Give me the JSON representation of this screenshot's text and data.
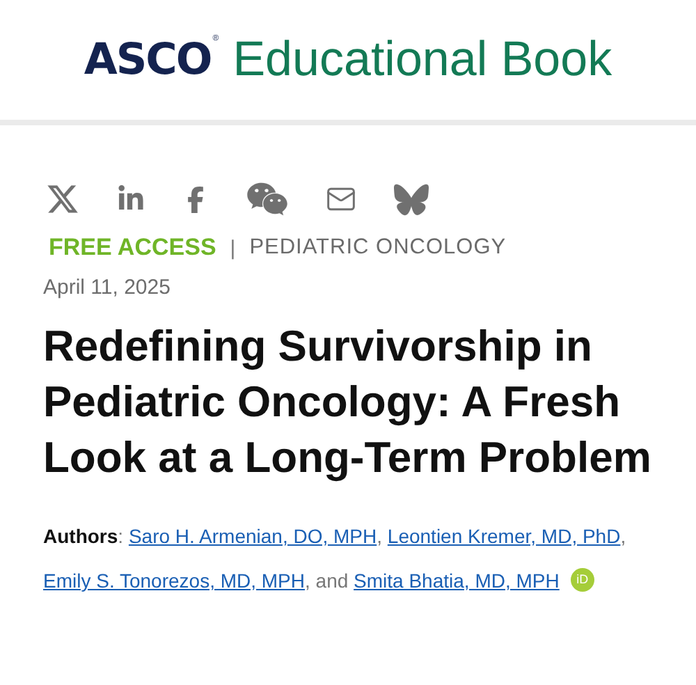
{
  "header": {
    "logo_mark": "ASCO",
    "logo_registered": "®",
    "logo_text": "Educational Book"
  },
  "share_icons": [
    {
      "kind": "x"
    },
    {
      "kind": "linkedin"
    },
    {
      "kind": "facebook"
    },
    {
      "kind": "chat"
    },
    {
      "kind": "mail"
    },
    {
      "kind": "butterfly"
    }
  ],
  "access": "FREE ACCESS",
  "separator": "|",
  "category": "PEDIATRIC ONCOLOGY",
  "date": "April 11, 2025",
  "title": "Redefining Survivorship in Pediatric Oncology: A Fresh Look at a Long-Term Problem",
  "authors": [
    {
      "kind": "label",
      "text": "Authors"
    },
    {
      "kind": "text",
      "text": ": "
    },
    {
      "kind": "link",
      "text": "Saro H. Armenian, DO, MPH"
    },
    {
      "kind": "text",
      "text": ", "
    },
    {
      "kind": "link",
      "text": "Leontien Kremer, MD, PhD"
    },
    {
      "kind": "text",
      "text": ", "
    },
    {
      "kind": "link",
      "text": "Emily S. Tonorezos, MD, MPH"
    },
    {
      "kind": "text",
      "text": ", and "
    },
    {
      "kind": "link",
      "text": "Smita Bhatia, MD, MPH"
    },
    {
      "kind": "orcid",
      "text": "iD"
    }
  ]
}
